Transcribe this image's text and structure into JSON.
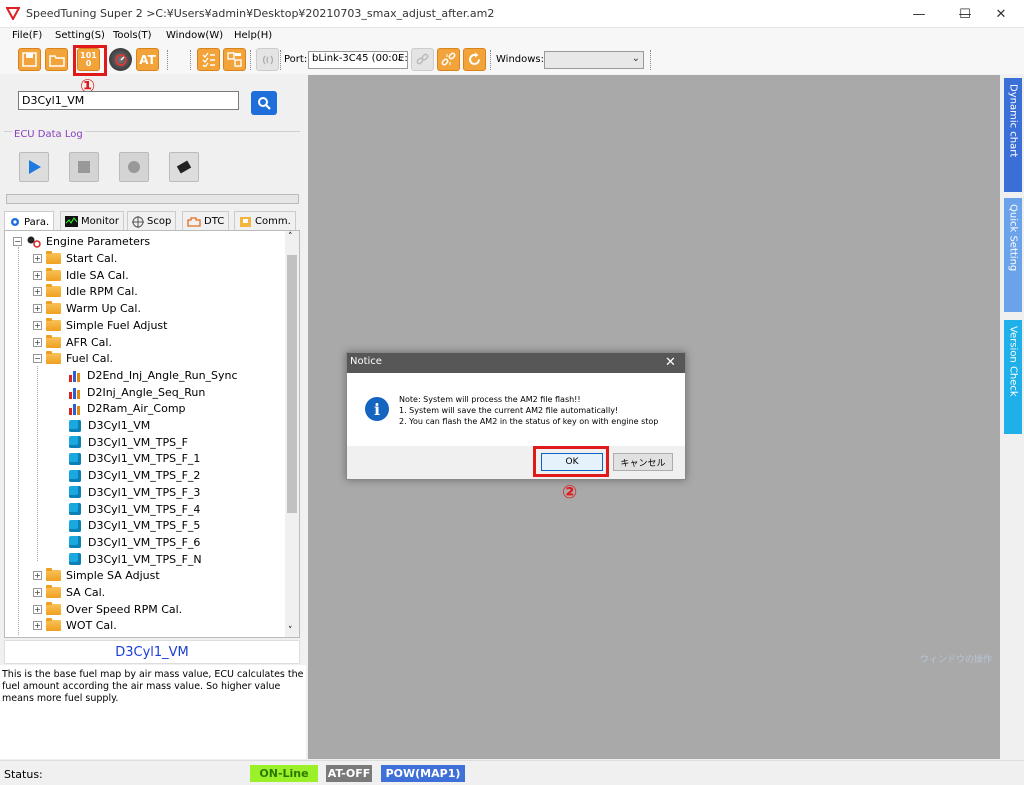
{
  "app": {
    "title": "SpeedTuning Super 2  >C:¥Users¥admin¥Desktop¥20210703_smax_adjust_after.am2",
    "controls": {
      "minimize": "—",
      "maximize": "☐",
      "close": "✕"
    }
  },
  "menu": [
    "File(F)",
    "Setting(S)",
    "Tools(T)",
    "Window(W)",
    "Help(H)"
  ],
  "toolbar": {
    "binary_label": "101\n0",
    "at_label": "AT",
    "port_label": "Port:",
    "port_value": "bLink-3C45 (00:0E:",
    "windows_label": "Windows:",
    "windows_value": ""
  },
  "search": {
    "value": "D3Cyl1_VM"
  },
  "ecu_log": {
    "title": "ECU Data Log",
    "progress": 0
  },
  "tabs": [
    "Para.",
    "Monitor",
    "Scop",
    "DTC",
    "Comm."
  ],
  "tree": {
    "root": "Engine Parameters",
    "items": [
      {
        "label": "Start Cal.",
        "type": "folder",
        "expander": "+"
      },
      {
        "label": "Idle SA Cal.",
        "type": "folder",
        "expander": "+"
      },
      {
        "label": "Idle RPM Cal.",
        "type": "folder",
        "expander": "+"
      },
      {
        "label": "Warm Up Cal.",
        "type": "folder",
        "expander": "+"
      },
      {
        "label": "Simple Fuel Adjust",
        "type": "folder",
        "expander": "+"
      },
      {
        "label": "AFR Cal.",
        "type": "folder",
        "expander": "+"
      },
      {
        "label": "Fuel Cal.",
        "type": "folder",
        "expander": "−"
      },
      {
        "label": "D2End_Inj_Angle_Run_Sync",
        "type": "chart"
      },
      {
        "label": "D2Inj_Angle_Seq_Run",
        "type": "chart"
      },
      {
        "label": "D2Ram_Air_Comp",
        "type": "chart"
      },
      {
        "label": "D3Cyl1_VM",
        "type": "cube"
      },
      {
        "label": "D3Cyl1_VM_TPS_F",
        "type": "cube"
      },
      {
        "label": "D3Cyl1_VM_TPS_F_1",
        "type": "cube"
      },
      {
        "label": "D3Cyl1_VM_TPS_F_2",
        "type": "cube"
      },
      {
        "label": "D3Cyl1_VM_TPS_F_3",
        "type": "cube"
      },
      {
        "label": "D3Cyl1_VM_TPS_F_4",
        "type": "cube"
      },
      {
        "label": "D3Cyl1_VM_TPS_F_5",
        "type": "cube"
      },
      {
        "label": "D3Cyl1_VM_TPS_F_6",
        "type": "cube"
      },
      {
        "label": "D3Cyl1_VM_TPS_F_N",
        "type": "cube"
      },
      {
        "label": "Simple SA Adjust",
        "type": "folder",
        "expander": "+"
      },
      {
        "label": "SA Cal.",
        "type": "folder",
        "expander": "+"
      },
      {
        "label": "Over Speed RPM Cal.",
        "type": "folder",
        "expander": "+"
      },
      {
        "label": "WOT Cal.",
        "type": "folder",
        "expander": "+"
      }
    ]
  },
  "selected": {
    "name": "D3Cyl1_VM",
    "description": "This is the base fuel map by air mass value, ECU calculates the fuel amount according the air mass value. So higher value means more fuel supply."
  },
  "side_tabs": [
    {
      "label": "Dynamic chart",
      "color": "#3b6fd8"
    },
    {
      "label": "Quick Setting",
      "color": "#6aa3ea"
    },
    {
      "label": "Version Check",
      "color": "#1fb0ea"
    }
  ],
  "watermark": "ウィンドウの操作",
  "dialog": {
    "title": "Notice",
    "close": "✕",
    "info_glyph": "i",
    "lines": [
      "Note: System will process the AM2  file flash!!",
      "1. System will save the current  AM2  file automatically!",
      "2. You can flash the AM2 in the status of key on with engine stop"
    ],
    "ok": "OK",
    "cancel": "キャンセル"
  },
  "steps": [
    "①",
    "②"
  ],
  "status": {
    "label": "Status:",
    "online": "ON-Line",
    "at": "AT-OFF",
    "pow": "POW(MAP1)",
    "colors": {
      "online": "#9cf02a",
      "at": "#7a7a7a",
      "pow": "#3f6fd8"
    }
  }
}
